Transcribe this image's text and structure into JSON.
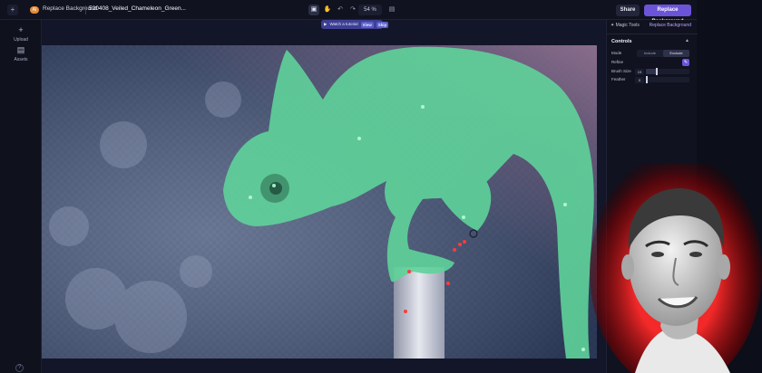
{
  "topbar": {
    "back_icon": "plus-icon",
    "badge": "AI",
    "app_title": "Replace Background",
    "file_name": "520408_Veiled_Chameleon_Green...",
    "zoom": "54 %",
    "share_label": "Share",
    "primary_label": "Replace Background",
    "tools": [
      "select-tool-icon",
      "hand-tool-icon",
      "undo-icon",
      "redo-icon",
      "fit-icon"
    ]
  },
  "leftrail": {
    "items": [
      {
        "icon": "plus-icon",
        "label": "Upload"
      },
      {
        "icon": "folder-icon",
        "label": "Assets"
      }
    ]
  },
  "canvas": {
    "tutorial_text": "Watch a tutorial",
    "tutorial_view": "View",
    "tutorial_skip": "Skip"
  },
  "panel": {
    "header_left": "Magic Tools",
    "header_right": "Replace Background",
    "section_title": "Controls",
    "mode_label": "Mode",
    "mode_options": [
      "Include",
      "Exclude"
    ],
    "mode_selected": "Exclude",
    "refine_label": "Refine",
    "brush_label": "Brush Size",
    "brush_value": "19",
    "brush_fraction": 0.25,
    "feather_label": "Feather",
    "feather_value": "0",
    "feather_fraction": 0.0
  },
  "colors": {
    "accent": "#6b54d8",
    "mask_green": "#5fd39a",
    "marker_red": "#ff3b3b"
  }
}
